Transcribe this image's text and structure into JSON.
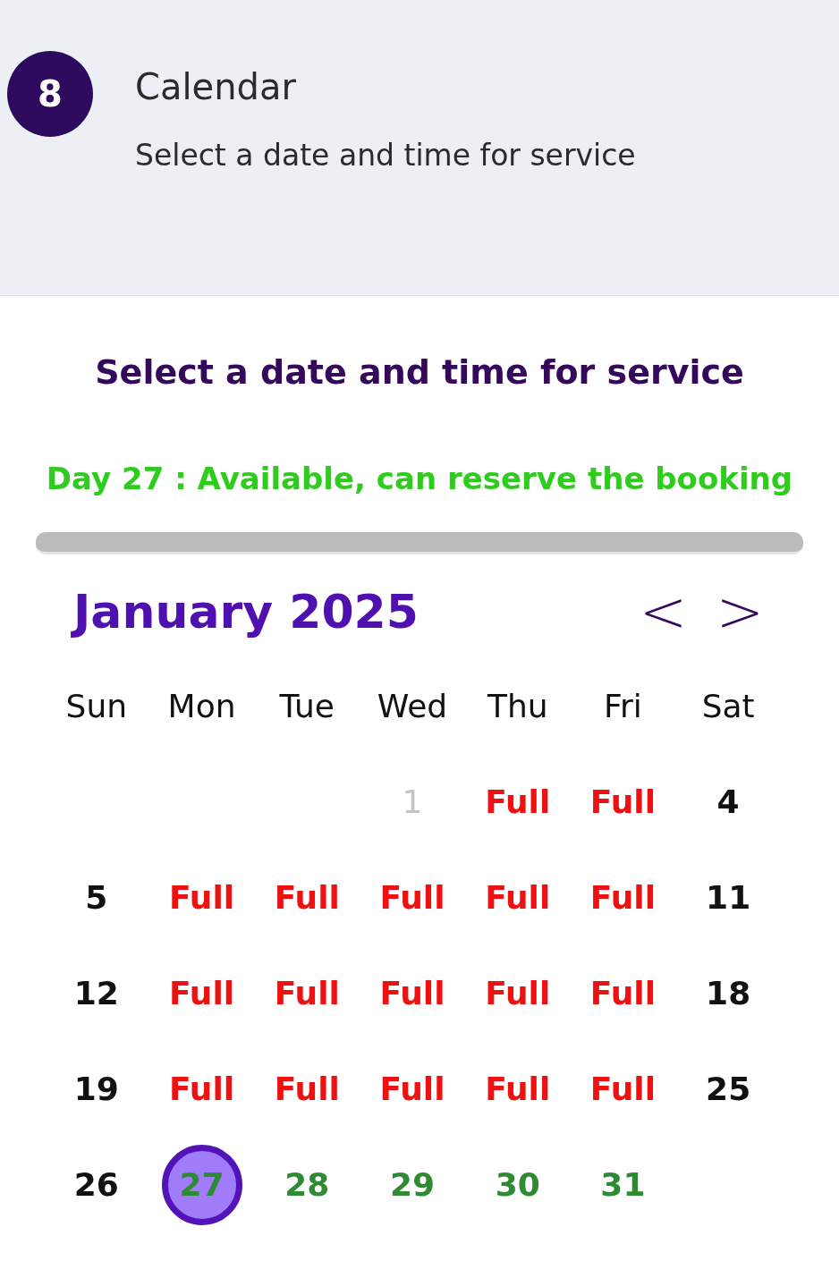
{
  "header": {
    "step": "8",
    "title": "Calendar",
    "subtitle": "Select a date and time for service"
  },
  "heading": "Select a date and time for service",
  "status": "Day 27 : Available, can reserve the booking",
  "calendar": {
    "month": "January 2025",
    "prev": "<",
    "next": ">",
    "weekdays": [
      "Sun",
      "Mon",
      "Tue",
      "Wed",
      "Thu",
      "Fri",
      "Sat"
    ],
    "weeks": [
      [
        {
          "kind": "empty"
        },
        {
          "kind": "empty"
        },
        {
          "kind": "empty"
        },
        {
          "kind": "disabled",
          "label": "1",
          "selected": false
        },
        {
          "kind": "full",
          "label": "Full",
          "selected": false
        },
        {
          "kind": "full",
          "label": "Full",
          "selected": false
        },
        {
          "kind": "open",
          "label": "4",
          "selected": false
        }
      ],
      [
        {
          "kind": "open",
          "label": "5",
          "selected": false
        },
        {
          "kind": "full",
          "label": "Full",
          "selected": false
        },
        {
          "kind": "full",
          "label": "Full",
          "selected": false
        },
        {
          "kind": "full",
          "label": "Full",
          "selected": false
        },
        {
          "kind": "full",
          "label": "Full",
          "selected": false
        },
        {
          "kind": "full",
          "label": "Full",
          "selected": false
        },
        {
          "kind": "open",
          "label": "11",
          "selected": false
        }
      ],
      [
        {
          "kind": "open",
          "label": "12",
          "selected": false
        },
        {
          "kind": "full",
          "label": "Full",
          "selected": false
        },
        {
          "kind": "full",
          "label": "Full",
          "selected": false
        },
        {
          "kind": "full",
          "label": "Full",
          "selected": false
        },
        {
          "kind": "full",
          "label": "Full",
          "selected": false
        },
        {
          "kind": "full",
          "label": "Full",
          "selected": false
        },
        {
          "kind": "open",
          "label": "18",
          "selected": false
        }
      ],
      [
        {
          "kind": "open",
          "label": "19",
          "selected": false
        },
        {
          "kind": "full",
          "label": "Full",
          "selected": false
        },
        {
          "kind": "full",
          "label": "Full",
          "selected": false
        },
        {
          "kind": "full",
          "label": "Full",
          "selected": false
        },
        {
          "kind": "full",
          "label": "Full",
          "selected": false
        },
        {
          "kind": "full",
          "label": "Full",
          "selected": false
        },
        {
          "kind": "open",
          "label": "25",
          "selected": false
        }
      ],
      [
        {
          "kind": "open",
          "label": "26",
          "selected": false
        },
        {
          "kind": "available",
          "label": "27",
          "selected": true
        },
        {
          "kind": "available",
          "label": "28",
          "selected": false
        },
        {
          "kind": "available",
          "label": "29",
          "selected": false
        },
        {
          "kind": "available",
          "label": "30",
          "selected": false
        },
        {
          "kind": "available",
          "label": "31",
          "selected": false
        },
        {
          "kind": "empty"
        }
      ]
    ]
  }
}
